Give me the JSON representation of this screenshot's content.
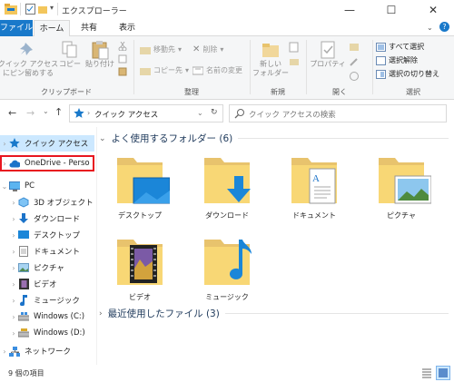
{
  "window": {
    "title": "エクスプローラー",
    "minimize": "—",
    "maximize": "☐",
    "close": "✕"
  },
  "tabs": {
    "file": "ファイル",
    "home": "ホーム",
    "share": "共有",
    "view": "表示"
  },
  "ribbon": {
    "clipboard": {
      "pin": "クイック アクセス\nにピン留めする",
      "copy": "コピー",
      "paste": "貼り付け",
      "group": "クリップボード"
    },
    "organize": {
      "move": "移動先",
      "copy_to": "コピー先",
      "delete": "削除",
      "rename": "名前の変更",
      "group": "整理"
    },
    "new": {
      "new_folder": "新しい\nフォルダー",
      "group": "新規"
    },
    "open": {
      "properties": "プロパティ",
      "group": "開く"
    },
    "select": {
      "select_all": "すべて選択",
      "select_none": "選択解除",
      "invert": "選択の切り替え",
      "group": "選択"
    }
  },
  "address": {
    "path": "クイック アクセス",
    "search_placeholder": "クイック アクセスの検索"
  },
  "nav": {
    "quick_access": "クイック アクセス",
    "onedrive": "OneDrive - Perso",
    "pc": "PC",
    "items": [
      "3D オブジェクト",
      "ダウンロード",
      "デスクトップ",
      "ドキュメント",
      "ピクチャ",
      "ビデオ",
      "ミュージック",
      "Windows (C:)",
      "Windows (D:)"
    ],
    "network": "ネットワーク"
  },
  "content": {
    "frequent_header": "よく使用するフォルダー (6)",
    "folders": [
      "デスクトップ",
      "ダウンロード",
      "ドキュメント",
      "ピクチャ",
      "ビデオ",
      "ミュージック"
    ],
    "recent_header": "最近使用したファイル (3)"
  },
  "status": {
    "count": "9 個の項目"
  },
  "colors": {
    "accent": "#1979ca",
    "selection": "#cce8ff",
    "highlight_border": "#e8161f",
    "folder": "#f8d775"
  }
}
